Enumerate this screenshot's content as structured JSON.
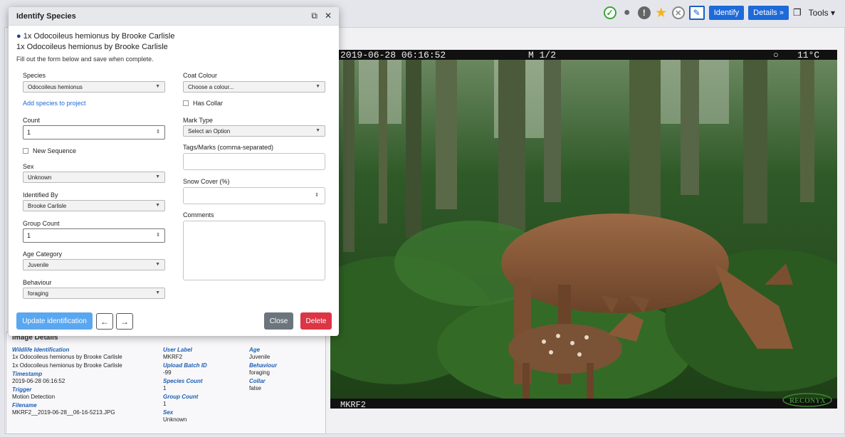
{
  "toolbar": {
    "identify_label": "Identify",
    "details_label": "Details »",
    "tools_label": "Tools ▾"
  },
  "modal": {
    "title": "Identify Species",
    "summary_bullet": "1x Odocoileus hemionus by Brooke Carlisle",
    "summary_line": "1x Odocoileus hemionus by Brooke Carlisle",
    "instructions": "Fill out the form below and save when complete.",
    "left": {
      "species_label": "Species",
      "species_value": "Odocoileus hemionus",
      "add_species_link": "Add species to project",
      "count_label": "Count",
      "count_value": "1",
      "new_sequence_label": "New Sequence",
      "sex_label": "Sex",
      "sex_value": "Unknown",
      "identified_by_label": "Identified By",
      "identified_by_value": "Brooke Carlisle",
      "group_count_label": "Group Count",
      "group_count_value": "1",
      "age_label": "Age Category",
      "age_value": "Juvenile",
      "behaviour_label": "Behaviour",
      "behaviour_value": "foraging"
    },
    "right": {
      "coat_label": "Coat Colour",
      "coat_value": "Choose a colour...",
      "collar_label": "Has Collar",
      "mark_type_label": "Mark Type",
      "mark_type_value": "Select an Option",
      "tags_label": "Tags/Marks (comma-separated)",
      "snow_label": "Snow Cover (%)",
      "comments_label": "Comments"
    },
    "buttons": {
      "update": "Update identification",
      "prev": "←",
      "next": "→",
      "close": "Close",
      "delete": "Delete"
    }
  },
  "camera": {
    "timestamp": "2019-06-28 06:16:52",
    "frame": "M 1/2",
    "temperature": "11°C",
    "temp_symbol": "○",
    "location": "MKRF2",
    "brand": "RECONYX"
  },
  "details": {
    "heading": "Image Details",
    "col1": [
      {
        "key": "Wildlife Identification",
        "values": [
          "1x Odocoileus hemionus by Brooke Carlisle",
          "1x Odocoileus hemionus by Brooke Carlisle"
        ]
      },
      {
        "key": "Timestamp",
        "values": [
          "2019-06-28 06:16:52"
        ]
      },
      {
        "key": "Trigger",
        "values": [
          "Motion Detection"
        ]
      },
      {
        "key": "Filename",
        "values": [
          "MKRF2__2019-06-28__06-16-5213.JPG"
        ]
      }
    ],
    "col2": [
      {
        "key": "User Label",
        "values": [
          "MKRF2"
        ]
      },
      {
        "key": "Upload Batch ID",
        "values": [
          "-99"
        ]
      },
      {
        "key": "Species Count",
        "values": [
          "1"
        ]
      },
      {
        "key": "Group Count",
        "values": [
          "1"
        ]
      },
      {
        "key": "Sex",
        "values": [
          "Unknown"
        ]
      }
    ],
    "col3": [
      {
        "key": "Age",
        "values": [
          "Juvenile"
        ]
      },
      {
        "key": "Behaviour",
        "values": [
          "foraging"
        ]
      },
      {
        "key": "Collar",
        "values": [
          "false"
        ]
      }
    ]
  }
}
